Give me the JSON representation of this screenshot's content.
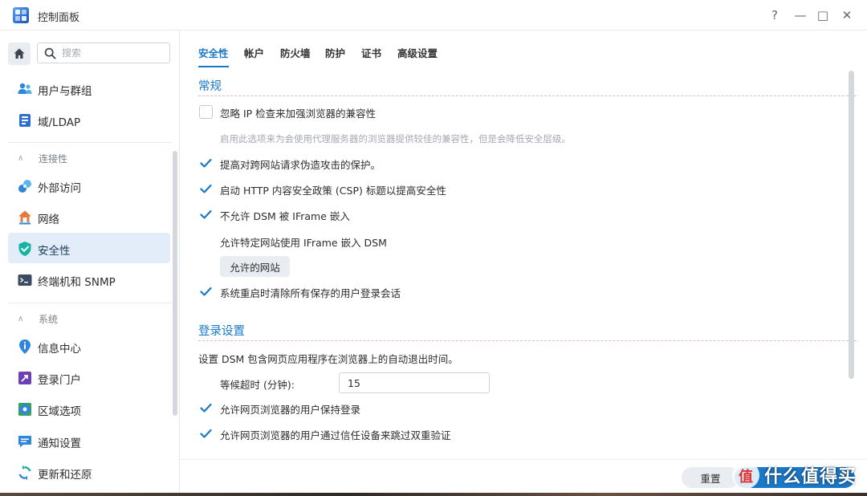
{
  "window": {
    "title": "控制面板",
    "help_icon": "?",
    "minimize_icon": "—",
    "maximize_icon": "□",
    "close_icon": "✕"
  },
  "sidebar": {
    "search_placeholder": "搜索",
    "items": [
      {
        "label": "用户与群组",
        "icon": "user-group-icon"
      },
      {
        "label": "域/LDAP",
        "icon": "domain-icon"
      },
      {
        "label": "外部访问",
        "icon": "external-access-icon"
      },
      {
        "label": "网络",
        "icon": "network-icon"
      },
      {
        "label": "安全性",
        "icon": "shield-check-icon",
        "active": true
      },
      {
        "label": "终端机和 SNMP",
        "icon": "terminal-icon"
      },
      {
        "label": "信息中心",
        "icon": "info-icon"
      },
      {
        "label": "登录门户",
        "icon": "login-portal-icon"
      },
      {
        "label": "区域选项",
        "icon": "regional-icon"
      },
      {
        "label": "通知设置",
        "icon": "notification-icon"
      },
      {
        "label": "更新和还原",
        "icon": "update-icon"
      }
    ],
    "groups": [
      {
        "label": "连接性"
      },
      {
        "label": "系统"
      }
    ]
  },
  "tabs": [
    {
      "label": "安全性",
      "active": true
    },
    {
      "label": "帐户"
    },
    {
      "label": "防火墙"
    },
    {
      "label": "防护"
    },
    {
      "label": "证书"
    },
    {
      "label": "高级设置"
    }
  ],
  "general": {
    "title": "常规",
    "ignore_ip": {
      "label": "忽略 IP 检查来加强浏览器的兼容性",
      "checked": false
    },
    "ignore_ip_hint": "启用此选项来为会使用代理服务器的浏览器提供较佳的兼容性，但是会降低安全层级。",
    "csrf": {
      "label": "提高对跨网站请求伪造攻击的保护。",
      "checked": true
    },
    "csp": {
      "label": "启动 HTTP 内容安全政策 (CSP) 标题以提高安全性",
      "checked": true
    },
    "no_iframe": {
      "label": "不允许 DSM 被 IFrame 嵌入",
      "checked": true
    },
    "allow_sites_text": "允许特定网站使用 IFrame 嵌入 DSM",
    "allowed_sites_button": "允许的网站",
    "clear_sessions": {
      "label": "系统重启时清除所有保存的用户登录会话",
      "checked": true
    }
  },
  "login": {
    "title": "登录设置",
    "description": "设置 DSM 包含网页应用程序在浏览器上的自动退出时间。",
    "timeout_label": "等候超时 (分钟):",
    "timeout_value": "15",
    "keep_login": {
      "label": "允许网页浏览器的用户保持登录",
      "checked": true
    },
    "skip_2fa": {
      "label": "允许网页浏览器的用户通过信任设备来跳过双重验证",
      "checked": true
    }
  },
  "footer": {
    "reset_label": "重置"
  },
  "watermark": {
    "logo_glyph": "值",
    "text": "什么值得买"
  },
  "colors": {
    "accent": "#1a78c8",
    "active_bg": "#e3edf9"
  }
}
